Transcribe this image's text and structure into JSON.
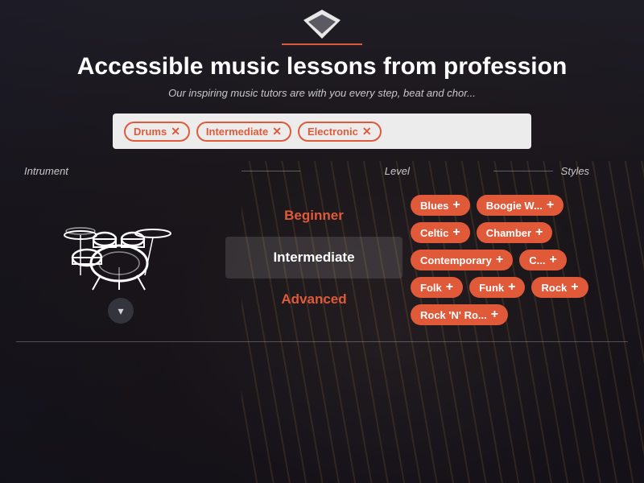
{
  "hero": {
    "title": "Accessible music lessons from profession",
    "subtitle": "Our inspiring music tutors are with you every step, beat and chor..."
  },
  "logo": {
    "line_color": "#e05a3a"
  },
  "filter_bar": {
    "tags": [
      {
        "id": "drums",
        "label": "Drums"
      },
      {
        "id": "intermediate",
        "label": "Intermediate"
      },
      {
        "id": "electronic",
        "label": "Electronic"
      }
    ]
  },
  "columns": {
    "instrument_header": "Intrument",
    "level_header": "Level",
    "styles_header": "Styles"
  },
  "levels": [
    {
      "id": "beginner",
      "label": "Beginner",
      "active": false
    },
    {
      "id": "intermediate",
      "label": "Intermediate",
      "active": true
    },
    {
      "id": "advanced",
      "label": "Advanced",
      "active": false
    }
  ],
  "styles": [
    {
      "id": "blues",
      "label": "Blues"
    },
    {
      "id": "boogie-w",
      "label": "Boogie W..."
    },
    {
      "id": "celtic",
      "label": "Celtic"
    },
    {
      "id": "chamber",
      "label": "Chamber"
    },
    {
      "id": "contemporary",
      "label": "Contemporary"
    },
    {
      "id": "c2",
      "label": "C..."
    },
    {
      "id": "folk",
      "label": "Folk"
    },
    {
      "id": "funk",
      "label": "Funk"
    },
    {
      "id": "rock",
      "label": "Rock"
    },
    {
      "id": "rock-n-ro",
      "label": "Rock 'N' Ro..."
    }
  ],
  "down_arrow": "▾"
}
